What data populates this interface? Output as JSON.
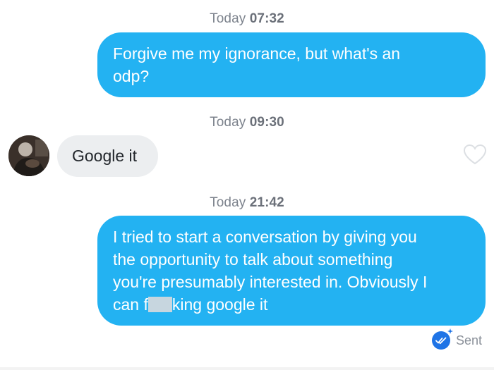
{
  "messages": [
    {
      "timestamp_day": "Today",
      "timestamp_time": "07:32",
      "direction": "outgoing",
      "lines": [
        "Forgive me my ignorance, but what's an",
        "odp?"
      ]
    },
    {
      "timestamp_day": "Today",
      "timestamp_time": "09:30",
      "direction": "incoming",
      "text": "Google it"
    },
    {
      "timestamp_day": "Today",
      "timestamp_time": "21:42",
      "direction": "outgoing",
      "lines": [
        "I tried to start a conversation by giving you",
        "the opportunity to talk about something",
        "you're presumably interested in. Obviously I"
      ],
      "last_line_prefix": "can f",
      "last_line_suffix": "king google it"
    }
  ],
  "status": {
    "label": "Sent",
    "icon": "double-check-icon"
  },
  "icons": {
    "like": "heart-outline-icon",
    "avatar": "avatar"
  },
  "colors": {
    "outgoing_bubble": "#23b2f2",
    "incoming_bubble": "#eceef0",
    "timestamp": "#7d838d",
    "sent_check": "#1f74e6"
  }
}
